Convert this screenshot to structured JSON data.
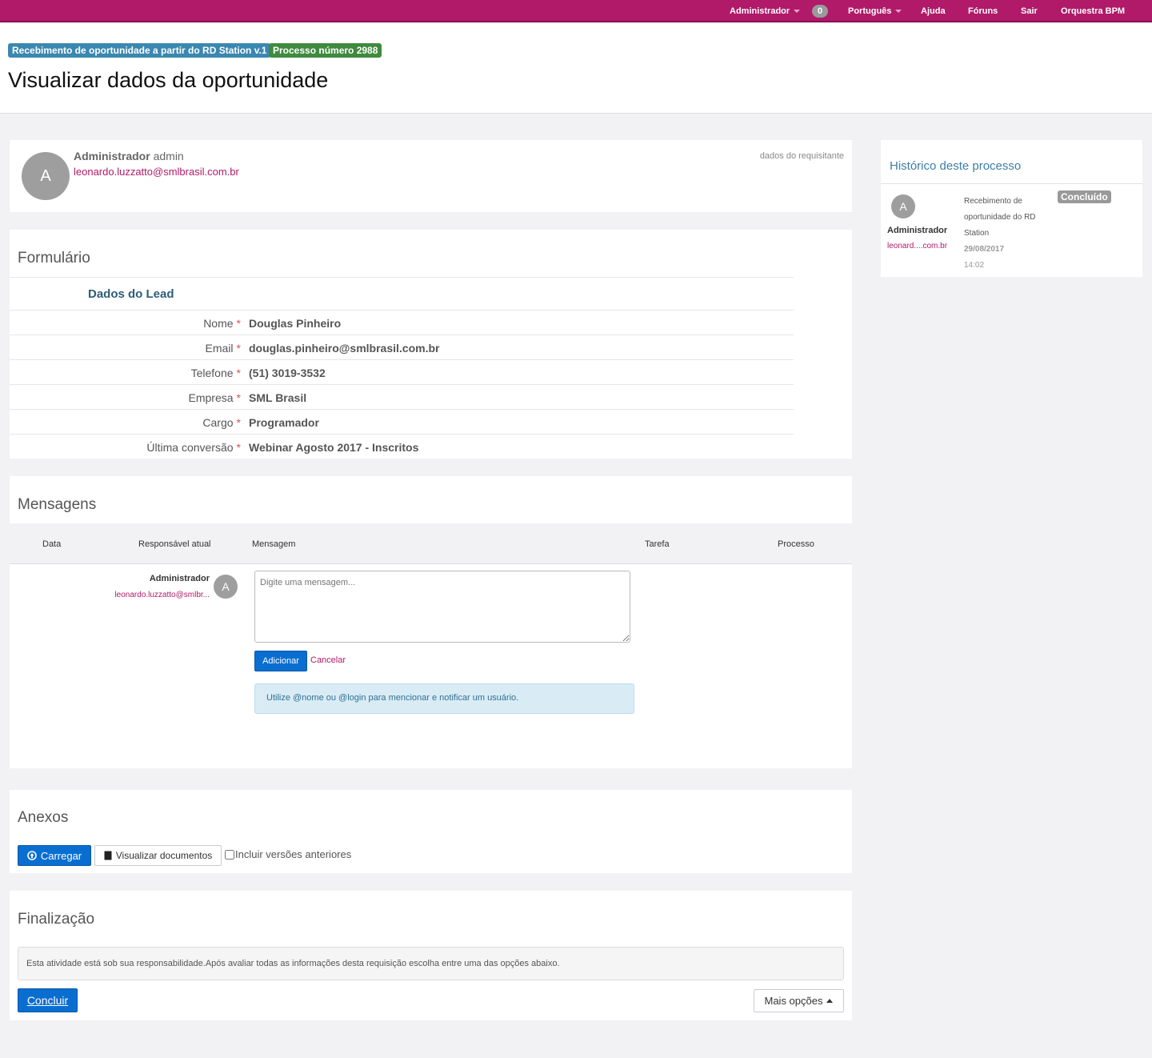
{
  "topbar": {
    "user_menu": "Administrador",
    "notifications_count": "0",
    "language_menu": "Português",
    "help": "Ajuda",
    "forums": "Fóruns",
    "logout": "Sair",
    "brand": "Orquestra BPM"
  },
  "header": {
    "process_label": "Recebimento de oportunidade a partir do RD Station v.1",
    "process_number_label": "Processo número 2988",
    "title": "Visualizar dados da oportunidade",
    "colors": {
      "topbar": "#b01a68",
      "process_label": "#3a88b0",
      "number_label": "#3f8a3f"
    }
  },
  "requester": {
    "avatar_letter": "A",
    "name": "Administrador",
    "login": "admin",
    "email": "leonardo.luzzatto@smlbrasil.com.br",
    "caption": "dados do requisitante"
  },
  "form": {
    "title": "Formulário",
    "subtitle": "Dados do Lead",
    "required_mark": "*",
    "fields": [
      {
        "label": "Nome",
        "value": "Douglas Pinheiro"
      },
      {
        "label": "Email",
        "value": "douglas.pinheiro@smlbrasil.com.br"
      },
      {
        "label": "Telefone",
        "value": "(51) 3019-3532"
      },
      {
        "label": "Empresa",
        "value": "SML Brasil"
      },
      {
        "label": "Cargo",
        "value": "Programador"
      },
      {
        "label": "Última conversão",
        "value": "Webinar Agosto 2017 - Inscritos"
      }
    ]
  },
  "messages": {
    "title": "Mensagens",
    "columns": [
      "Data",
      "Responsável atual",
      "Mensagem",
      "Tarefa",
      "Processo"
    ],
    "author_name": "Administrador",
    "author_email": "leonardo.luzzatto@smlbr...",
    "avatar_letter": "A",
    "input_placeholder": "Digite uma mensagem...",
    "add_button": "Adicionar",
    "cancel_link": "Cancelar",
    "hint": "Utilize @nome ou @login para mencionar e notificar um usuário."
  },
  "attachments": {
    "title": "Anexos",
    "upload_button": "Carregar",
    "view_button": "Visualizar documentos",
    "include_versions_label": "Incluir versões anteriores",
    "include_versions_checked": false
  },
  "finalization": {
    "title": "Finalização",
    "notice": "Esta atividade está sob sua responsabilidade.Após avaliar todas as informações desta requisição escolha entre uma das opções abaixo.",
    "conclude_button": "Concluir",
    "more_options_button": "Mais opções"
  },
  "history": {
    "title": "Histórico deste processo",
    "entry": {
      "avatar_letter": "A",
      "user": "Administrador",
      "email": "leonard....com.br",
      "task_line1": "Recebimento de",
      "task_line2": "oportunidade do RD",
      "task_line3": "Station",
      "date": "29/08/2017",
      "time": "14:02",
      "status": "Concluído"
    }
  }
}
